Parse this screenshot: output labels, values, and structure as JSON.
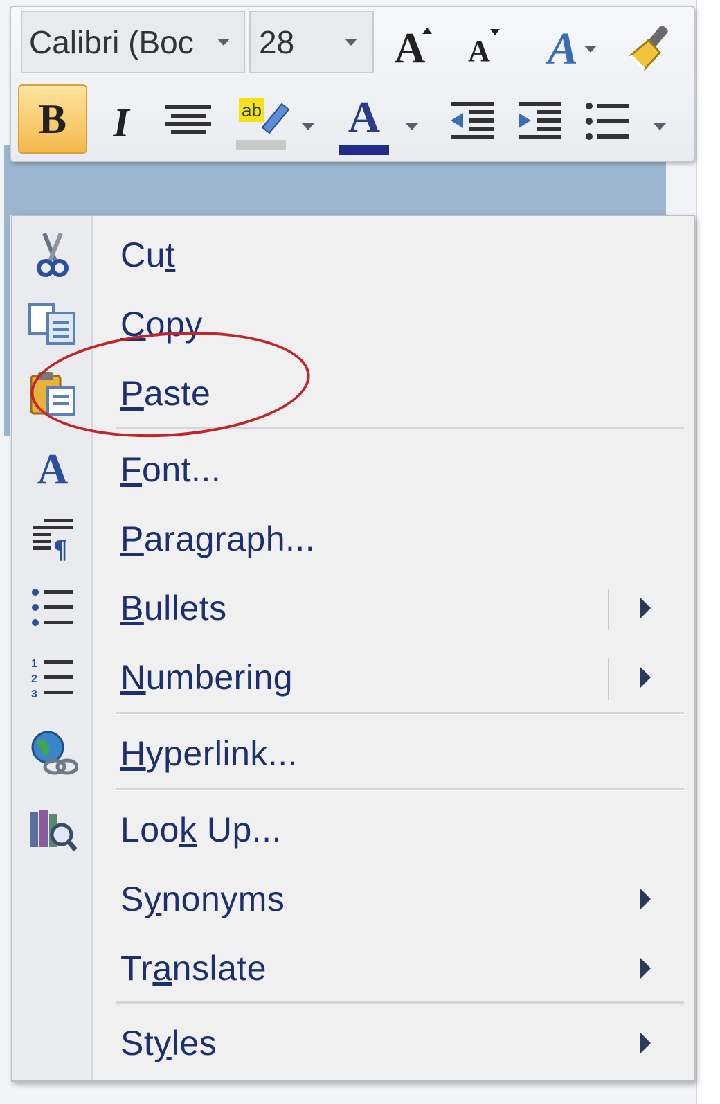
{
  "toolbar": {
    "font_name": "Calibri (Boc",
    "font_size": "28",
    "grow_font_glyph": "A",
    "shrink_font_glyph": "A",
    "styles_glyph": "A",
    "bold_glyph": "B",
    "italic_glyph": "I",
    "font_color_glyph": "A",
    "highlight_glyph": "ab",
    "highlight_color": "#f5e11a",
    "font_color": "#1f2a8a"
  },
  "menu": {
    "items": [
      {
        "pre": "Cu",
        "u": "t",
        "post": ""
      },
      {
        "pre": "",
        "u": "C",
        "post": "opy"
      },
      {
        "pre": "",
        "u": "P",
        "post": "aste"
      },
      {
        "pre": "",
        "u": "F",
        "post": "ont..."
      },
      {
        "pre": "",
        "u": "P",
        "post": "aragraph..."
      },
      {
        "pre": "",
        "u": "B",
        "post": "ullets"
      },
      {
        "pre": "",
        "u": "N",
        "post": "umbering"
      },
      {
        "pre": "",
        "u": "H",
        "post": "yperlink..."
      },
      {
        "pre": "Loo",
        "u": "k",
        "post": " Up..."
      },
      {
        "pre": "S",
        "u": "y",
        "post": "nonyms"
      },
      {
        "pre": "Tr",
        "u": "a",
        "post": "nslate"
      },
      {
        "pre": "St",
        "u": "y",
        "post": "les"
      }
    ],
    "icons": {
      "font_glyph": "A"
    }
  },
  "colors": {
    "menu_text": "#1c2f6e",
    "annotation": "#c0252a",
    "selection": "#9cb6cf"
  }
}
